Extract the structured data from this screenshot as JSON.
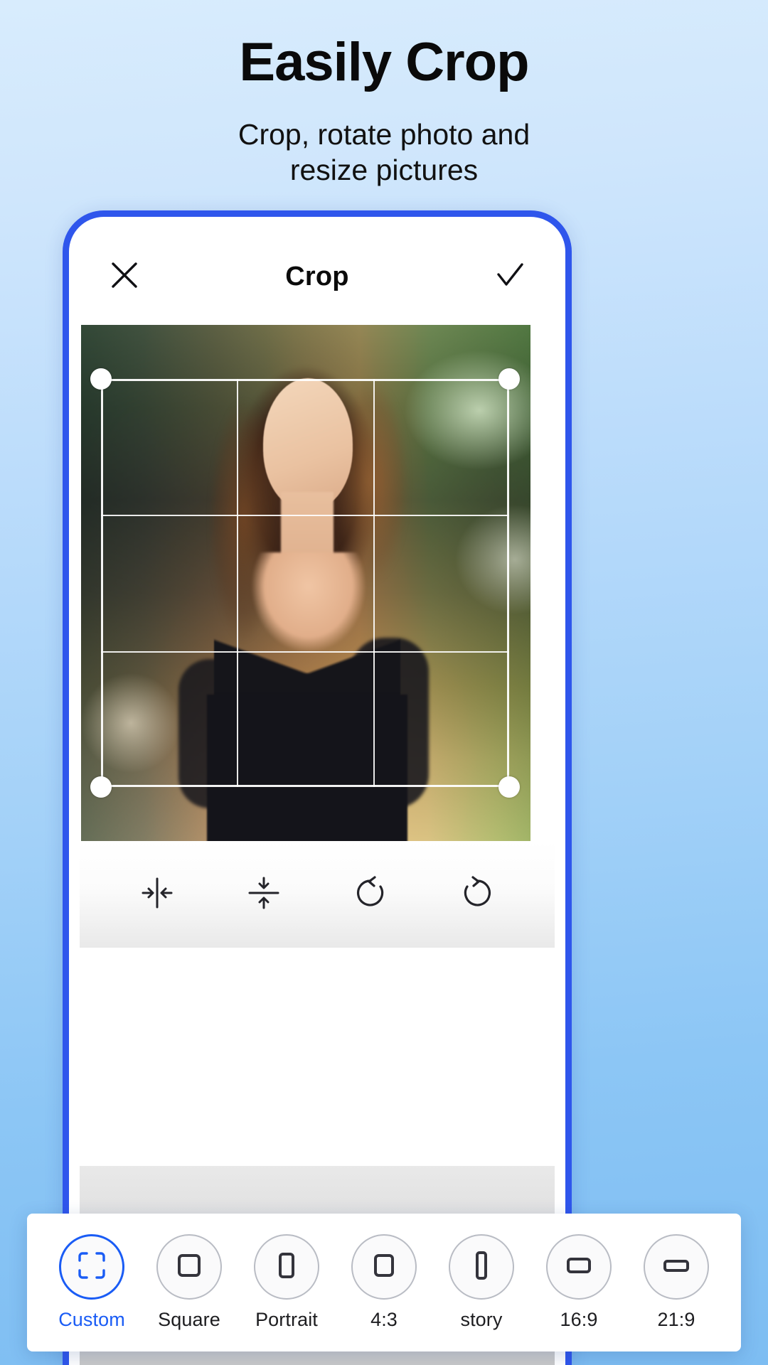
{
  "promo": {
    "title": "Easily Crop",
    "subtitle_line1": "Crop, rotate photo and",
    "subtitle_line2": "resize pictures"
  },
  "colors": {
    "accent_blue": "#1a5cf5",
    "phone_border": "#2f56ec",
    "bg_top": "#d8ecfd",
    "bg_bottom": "#7dbdf2",
    "icon_dark": "#1b1b1f"
  },
  "app": {
    "header": {
      "close_icon": "close-x-icon",
      "title": "Crop",
      "confirm_icon": "checkmark-icon"
    },
    "tools": [
      {
        "id": "flip-horizontal",
        "icon": "flip-horizontal-icon"
      },
      {
        "id": "flip-vertical",
        "icon": "flip-vertical-icon"
      },
      {
        "id": "rotate-left",
        "icon": "rotate-left-icon"
      },
      {
        "id": "rotate-right",
        "icon": "rotate-right-icon"
      }
    ],
    "aspect_ratios": [
      {
        "label": "Custom",
        "icon": "custom-crop-icon",
        "selected": true
      },
      {
        "label": "Square",
        "icon": "square-icon",
        "selected": false
      },
      {
        "label": "Portrait",
        "icon": "portrait-icon",
        "selected": false
      },
      {
        "label": "4:3",
        "icon": "ratio-4-3-icon",
        "selected": false
      },
      {
        "label": "story",
        "icon": "story-icon",
        "selected": false
      },
      {
        "label": "16:9",
        "icon": "ratio-16-9-icon",
        "selected": false
      },
      {
        "label": "21:9",
        "icon": "ratio-21-9-icon",
        "selected": false
      }
    ],
    "crop_overlay": {
      "grid": "rule-of-thirds",
      "handles": 4
    }
  }
}
